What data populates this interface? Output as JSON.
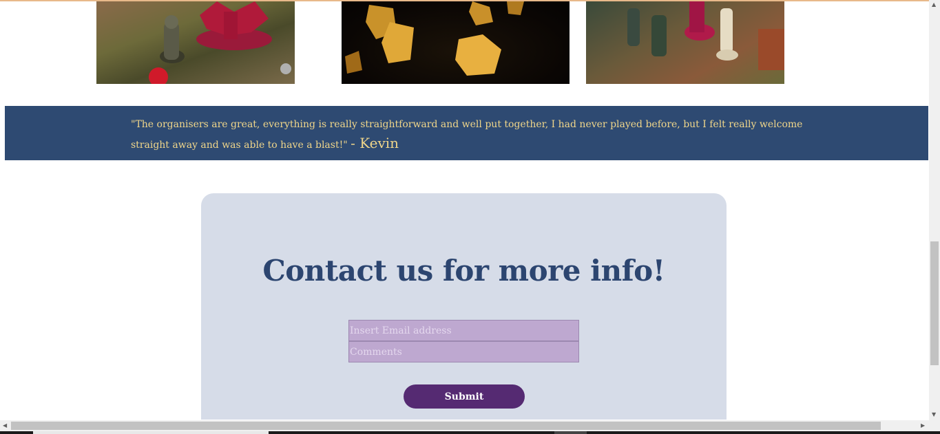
{
  "gallery": [
    {
      "alt": "Red dragon miniature and knight figures on a game board"
    },
    {
      "alt": "Golden polyhedral dice on dark background"
    },
    {
      "alt": "Tabletop miniatures battle scene"
    }
  ],
  "testimonial": {
    "quote": "\"The organisers are great, everything is really straightforward and well put together, I had never played before, but I felt really welcome straight away and was able to have a blast!\"",
    "author": "- Kevin"
  },
  "contact": {
    "title": "Contact us for more info!",
    "email_placeholder": "Insert Email address",
    "comments_placeholder": "Comments",
    "submit_label": "Submit"
  },
  "colors": {
    "banner": "#2e4a72",
    "quote_text": "#f0d68a",
    "card": "#d6dce8",
    "title": "#2c4570",
    "field": "#bea8d0",
    "submit": "#552a72"
  }
}
